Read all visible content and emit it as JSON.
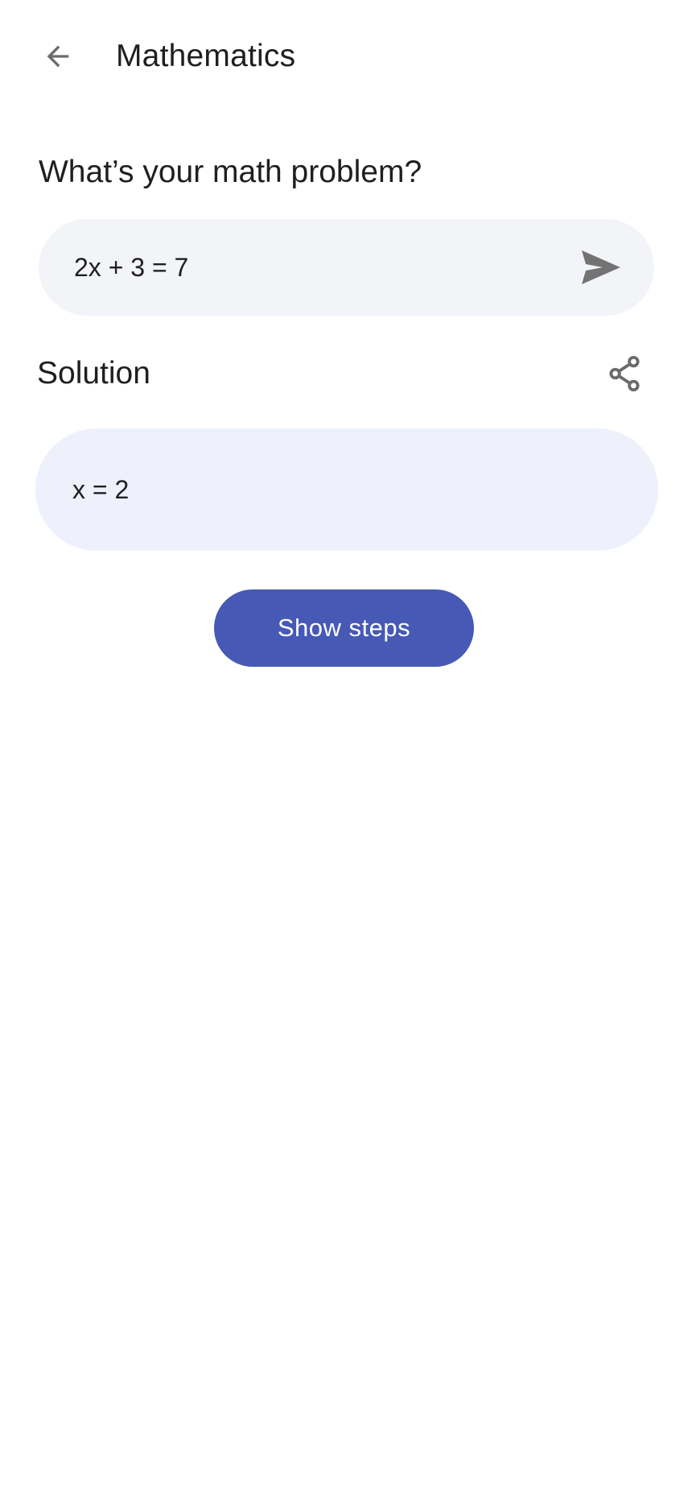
{
  "app_bar": {
    "title": "Mathematics",
    "back_icon": "arrow-back-icon"
  },
  "problem": {
    "prompt": "What’s your math problem?",
    "input_value": "2x + 3 = 7",
    "send_icon": "send-icon"
  },
  "solution": {
    "heading": "Solution",
    "share_icon": "share-icon",
    "result": "x = 2"
  },
  "actions": {
    "show_steps_label": "Show steps"
  },
  "colors": {
    "accent": "#4659b5",
    "input_background": "#f3f4f8",
    "solution_background": "#eef0fc",
    "icon_gray": "#6b6b6b"
  }
}
